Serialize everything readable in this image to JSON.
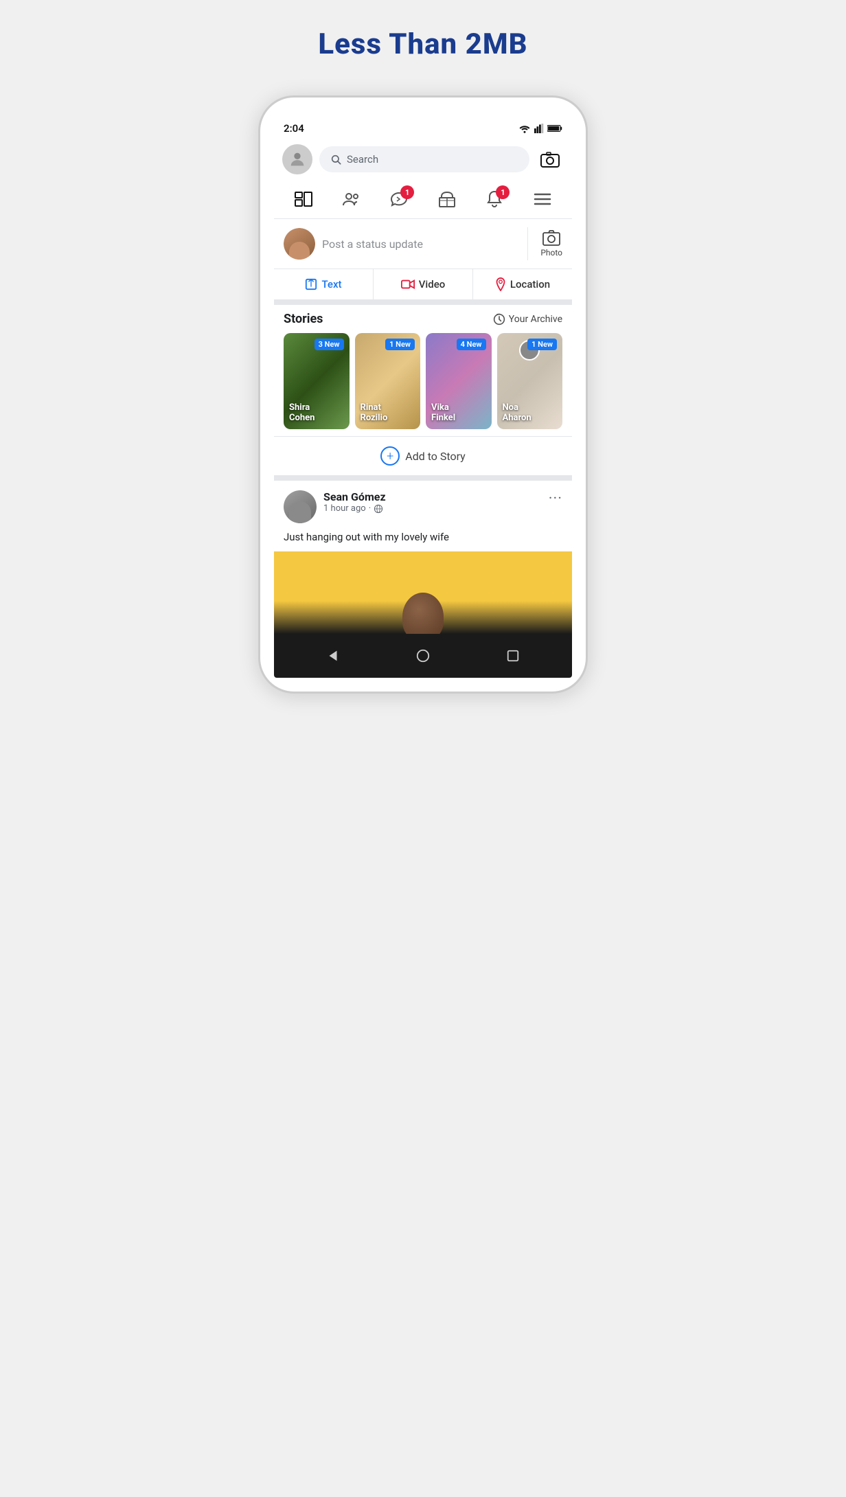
{
  "headline": "Less Than 2MB",
  "status_bar": {
    "time": "2:04"
  },
  "search": {
    "placeholder": "Search"
  },
  "nav": {
    "items": [
      {
        "id": "feed",
        "label": "Feed"
      },
      {
        "id": "friends",
        "label": "Friends"
      },
      {
        "id": "messages",
        "label": "Messages",
        "badge": "1"
      },
      {
        "id": "marketplace",
        "label": "Marketplace"
      },
      {
        "id": "notifications",
        "label": "Notifications",
        "badge": "1"
      },
      {
        "id": "menu",
        "label": "Menu"
      }
    ]
  },
  "composer": {
    "placeholder": "Post a status update",
    "photo_label": "Photo"
  },
  "post_actions": [
    {
      "id": "text",
      "label": "Text"
    },
    {
      "id": "video",
      "label": "Video"
    },
    {
      "id": "location",
      "label": "Location"
    }
  ],
  "stories": {
    "title": "Stories",
    "archive_label": "Your Archive",
    "cards": [
      {
        "name": "Shira\nCohen",
        "new_count": "3 New"
      },
      {
        "name": "Rinat\nRozilio",
        "new_count": "1 New"
      },
      {
        "name": "Vika\nFinkel",
        "new_count": "4 New"
      },
      {
        "name": "Noa\nAharon",
        "new_count": "1 New"
      }
    ],
    "add_label": "Add to Story"
  },
  "post": {
    "author": "Sean Gómez",
    "time": "1 hour ago",
    "visibility": "globe",
    "text": "Just hanging out with my lovely wife"
  },
  "bottom_nav": {
    "back": "◁",
    "home": "○",
    "recent": "□"
  }
}
